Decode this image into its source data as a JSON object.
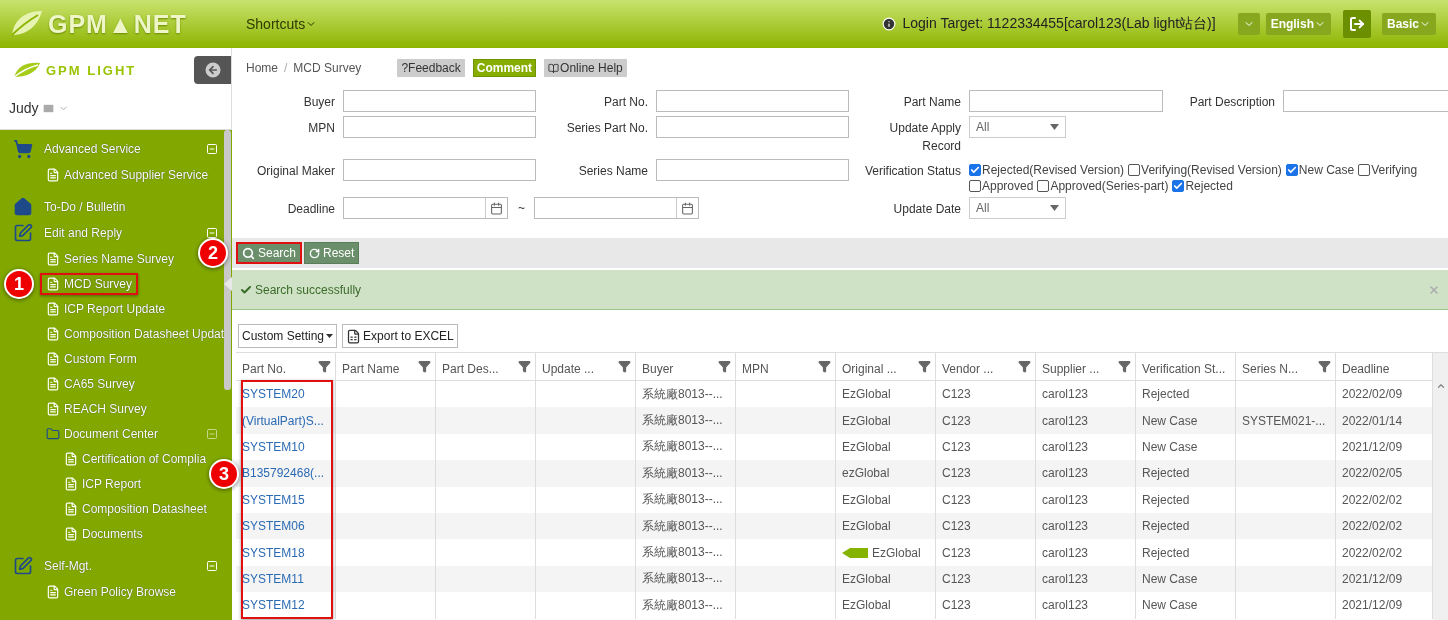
{
  "header": {
    "logo": "GPM▲NET",
    "shortcuts": "Shortcuts",
    "login_target": "Login Target: 1122334455[carol123(Lab light站台)]",
    "language": "English",
    "mode": "Basic"
  },
  "sidebar": {
    "logo": "GPM LIGHT",
    "user": "Judy",
    "items": [
      {
        "label": "Advanced Service",
        "kind": "cart",
        "expanded": true,
        "children": [
          {
            "label": "Advanced Supplier Service",
            "kind": "file",
            "selected": false
          }
        ]
      },
      {
        "label": "To-Do / Bulletin",
        "kind": "home",
        "selected": false
      },
      {
        "label": "Edit and Reply",
        "kind": "edit",
        "expanded": true,
        "children": [
          {
            "label": "Series Name Survey",
            "kind": "file",
            "selected": false
          },
          {
            "label": "MCD Survey",
            "kind": "file",
            "selected": true,
            "callout": "1"
          },
          {
            "label": "ICP Report Update",
            "kind": "file",
            "selected": false
          },
          {
            "label": "Composition Datasheet Updat",
            "kind": "file",
            "selected": false
          },
          {
            "label": "Custom Form",
            "kind": "file",
            "selected": false
          },
          {
            "label": "CA65 Survey",
            "kind": "file",
            "selected": false
          },
          {
            "label": "REACH Survey",
            "kind": "file",
            "selected": false
          },
          {
            "label": "Document Center",
            "kind": "folder",
            "expanded": true,
            "children": [
              {
                "label": "Certification of Complia",
                "kind": "file",
                "selected": false
              },
              {
                "label": "ICP Report",
                "kind": "file",
                "selected": false
              },
              {
                "label": "Composition Datasheet",
                "kind": "file",
                "selected": false
              },
              {
                "label": "Documents",
                "kind": "file",
                "selected": false
              }
            ]
          }
        ]
      },
      {
        "label": "Self-Mgt.",
        "kind": "edit",
        "expanded": true,
        "children": [
          {
            "label": "Green Policy Browse",
            "kind": "file",
            "selected": false
          }
        ]
      }
    ]
  },
  "breadcrumb": {
    "items": [
      "Home",
      "MCD Survey"
    ],
    "separator": "/"
  },
  "actions": [
    {
      "label": "?Feedback",
      "kind": "feedback"
    },
    {
      "label": "Comment",
      "kind": "primary"
    },
    {
      "label": "Online Help",
      "kind": "help"
    }
  ],
  "filters": [
    [
      {
        "label": "Buyer",
        "kind": "text"
      },
      {
        "label": "Part No.",
        "kind": "text"
      },
      {
        "label": "Part Name",
        "kind": "text"
      },
      {
        "label": "Part Description",
        "kind": "text"
      }
    ],
    [
      {
        "label": "MPN",
        "kind": "text"
      },
      {
        "label": "Series Part No.",
        "kind": "text"
      },
      {
        "label": "Update Apply Record",
        "kind": "select",
        "value": "All"
      }
    ],
    [
      {
        "label": "Original Maker",
        "kind": "text"
      },
      {
        "label": "Series Name",
        "kind": "text"
      },
      {
        "label": "Verification Status",
        "kind": "checks",
        "options": [
          {
            "label": "Rejected(Revised Version)",
            "checked": true
          },
          {
            "label": "Verifying(Revised Version)",
            "checked": false
          },
          {
            "label": "New Case",
            "checked": true
          },
          {
            "label": "Verifying",
            "checked": false
          },
          {
            "label": "Approved",
            "checked": false
          },
          {
            "label": "Approved(Series-part)",
            "checked": false
          },
          {
            "label": "Rejected",
            "checked": true
          }
        ]
      }
    ],
    [
      {
        "label": "Deadline",
        "kind": "daterange",
        "separator": "~"
      },
      {
        "label": "Update Date",
        "kind": "select",
        "value": "All"
      }
    ]
  ],
  "buttons": [
    {
      "label": "Search",
      "kind": "search",
      "callout": "2"
    },
    {
      "label": "Reset",
      "kind": "reset"
    }
  ],
  "alert": "Search successfully",
  "table_tools": {
    "settings": "Custom Setting",
    "export": "Export to EXCEL"
  },
  "table": {
    "columns": [
      {
        "label": "Part No.",
        "filter": true,
        "callout": "3"
      },
      {
        "label": "Part Name",
        "filter": true
      },
      {
        "label": "Part Des...",
        "filter": true
      },
      {
        "label": "Update ...",
        "filter": true
      },
      {
        "label": "Buyer",
        "filter": true
      },
      {
        "label": "MPN",
        "filter": true
      },
      {
        "label": "Original ...",
        "filter": true
      },
      {
        "label": "Vendor ...",
        "filter": true
      },
      {
        "label": "Supplier ...",
        "filter": true
      },
      {
        "label": "Verification St...",
        "filter": false
      },
      {
        "label": "Series N...",
        "filter": true
      },
      {
        "label": "Deadline",
        "filter": false
      }
    ],
    "rows": [
      {
        "part_no": "SYSTEM20",
        "buyer": "系統廠8013--...",
        "maker": "EzGlobal",
        "vendor": "C123",
        "supplier": "carol123",
        "status": "Rejected",
        "deadline": "2022/02/09"
      },
      {
        "part_no": "(VirtualPart)S...",
        "buyer": "系統廠8013--...",
        "maker": "EzGlobal",
        "vendor": "C123",
        "supplier": "carol123",
        "status": "New Case",
        "series": "SYSTEM021-...",
        "deadline": "2022/01/14"
      },
      {
        "part_no": "SYSTEM10",
        "buyer": "系統廠8013--...",
        "maker": "EzGlobal",
        "vendor": "C123",
        "supplier": "carol123",
        "status": "New Case",
        "deadline": "2021/12/09"
      },
      {
        "part_no": "B135792468(...",
        "buyer": "系統廠8013--...",
        "maker": "ezGlobal",
        "vendor": "C123",
        "supplier": "carol123",
        "status": "Rejected",
        "deadline": "2022/02/05"
      },
      {
        "part_no": "SYSTEM15",
        "buyer": "系統廠8013--...",
        "maker": "EzGlobal",
        "vendor": "C123",
        "supplier": "carol123",
        "status": "Rejected",
        "deadline": "2022/02/02"
      },
      {
        "part_no": "SYSTEM06",
        "buyer": "系統廠8013--...",
        "maker": "EzGlobal",
        "vendor": "C123",
        "supplier": "carol123",
        "status": "Rejected",
        "deadline": "2022/02/02"
      },
      {
        "part_no": "SYSTEM18",
        "buyer": "系統廠8013--...",
        "maker": "EzGlobal",
        "vendor": "C123",
        "supplier": "carol123",
        "status": "Rejected",
        "deadline": "2022/02/02",
        "pointer": true
      },
      {
        "part_no": "SYSTEM11",
        "buyer": "系統廠8013--...",
        "maker": "EzGlobal",
        "vendor": "C123",
        "supplier": "carol123",
        "status": "New Case",
        "deadline": "2021/12/09"
      },
      {
        "part_no": "SYSTEM12",
        "buyer": "系統廠8013--...",
        "maker": "EzGlobal",
        "vendor": "C123",
        "supplier": "carol123",
        "status": "New Case",
        "deadline": "2021/12/09"
      }
    ]
  }
}
